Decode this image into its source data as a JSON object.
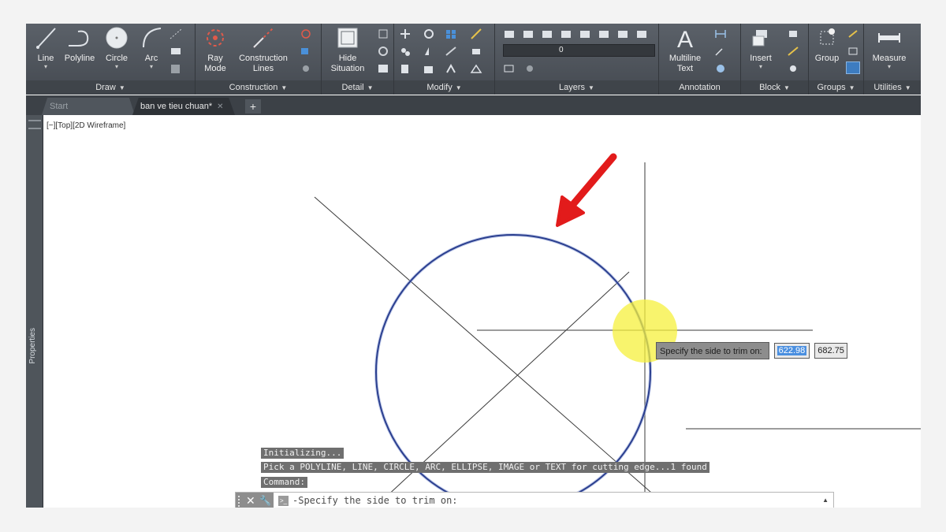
{
  "ribbon": {
    "panels": {
      "draw": "Draw",
      "construction": "Construction",
      "detail": "Detail",
      "modify": "Modify",
      "layers": "Layers",
      "annotation": "Annotation",
      "block": "Block",
      "groups": "Groups",
      "utilities": "Utilities"
    },
    "tools": {
      "line": "Line",
      "polyline": "Polyline",
      "circle": "Circle",
      "arc": "Arc",
      "ray_mode_1": "Ray",
      "ray_mode_2": "Mode",
      "construction_lines_1": "Construction",
      "construction_lines_2": "Lines",
      "hide_situation_1": "Hide",
      "hide_situation_2": "Situation",
      "multiline_text_1": "Multiline",
      "multiline_text_2": "Text",
      "insert": "Insert",
      "group": "Group",
      "measure": "Measure"
    },
    "layer_current": "0"
  },
  "tabs": {
    "start": "Start",
    "file": "ban ve tieu chuan*",
    "add": "+"
  },
  "side_panel": {
    "label": "Properties"
  },
  "viewport": {
    "label": "[−][Top][2D Wireframe]"
  },
  "tooltip": {
    "message": "Specify the side to trim on:",
    "x_value": "622.98",
    "y_value": "682.75"
  },
  "command_history": [
    "Initializing...",
    "Pick a POLYLINE, LINE, CIRCLE, ARC, ELLIPSE, IMAGE or TEXT for cutting edge...1 found",
    "Command:"
  ],
  "command_line": {
    "prompt": "Specify the side to trim on:"
  },
  "colors": {
    "ribbon": "#4e535a",
    "circle": "#2b3f8f",
    "arrow": "#e21b1b",
    "highlight": "#f5f03c"
  }
}
